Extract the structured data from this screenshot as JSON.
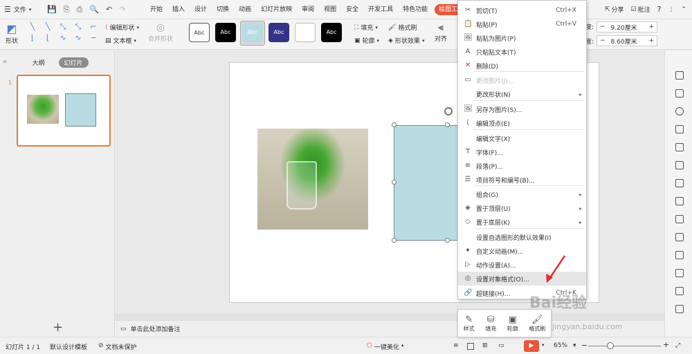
{
  "menubar": {
    "file_label": "文件",
    "tabs": [
      "开始",
      "插入",
      "设计",
      "切换",
      "动画",
      "幻灯片放映",
      "审阅",
      "视图",
      "安全",
      "开发工具",
      "特色功能",
      "绘图工具",
      "文"
    ],
    "active_tab": "绘图工具",
    "share_label": "分享",
    "comment_label": "批注",
    "help_label": "?"
  },
  "ribbon": {
    "shape_label": "形状",
    "edit_shape_label": "编辑形状",
    "textbox_label": "文本框",
    "merge_shape_label": "合并形状",
    "style_abc": "Abc",
    "fill_label": "填充",
    "outline_label": "轮廓",
    "format_brush_label": "格式刷",
    "shape_effect_label": "形状效果",
    "align_label": "对齐",
    "height_prefix": "度:",
    "width_prefix": "度:",
    "height_value": "9.20厘米",
    "width_value": "8.60厘米"
  },
  "leftpanel": {
    "outline_tab": "大纲",
    "slides_tab": "幻灯片",
    "slide_number": "1",
    "add_label": "+"
  },
  "notes": {
    "placeholder": "单击此处添加备注"
  },
  "context_menu": {
    "items": [
      {
        "label": "剪切(T)",
        "shortcut": "Ctrl+X",
        "icon": "scissors-icon",
        "disabled": false,
        "submenu": false
      },
      {
        "label": "粘贴(P)",
        "shortcut": "Ctrl+V",
        "icon": "paste-icon",
        "disabled": false,
        "submenu": false
      },
      {
        "label": "粘贴为图片(P)",
        "shortcut": "",
        "icon": "paste-picture-icon",
        "disabled": false,
        "submenu": false
      },
      {
        "label": "只粘贴文本(T)",
        "shortcut": "",
        "icon": "paste-text-icon",
        "disabled": false,
        "submenu": false
      },
      {
        "label": "删除(D)",
        "shortcut": "",
        "icon": "delete-icon",
        "disabled": false,
        "submenu": false
      },
      {
        "label": "更改图片(J)...",
        "shortcut": "",
        "icon": "change-picture-icon",
        "disabled": true,
        "submenu": false
      },
      {
        "label": "更改形状(N)",
        "shortcut": "",
        "icon": "",
        "disabled": false,
        "submenu": true
      },
      {
        "label": "另存为图片(S)...",
        "shortcut": "",
        "icon": "save-picture-icon",
        "disabled": false,
        "submenu": false
      },
      {
        "label": "编辑顶点(E)",
        "shortcut": "",
        "icon": "edit-points-icon",
        "disabled": false,
        "submenu": false
      },
      {
        "label": "编辑文字(X)",
        "shortcut": "",
        "icon": "",
        "disabled": false,
        "submenu": false
      },
      {
        "label": "字体(F)...",
        "shortcut": "",
        "icon": "font-icon",
        "disabled": false,
        "submenu": false
      },
      {
        "label": "段落(P)...",
        "shortcut": "",
        "icon": "paragraph-icon",
        "disabled": false,
        "submenu": false
      },
      {
        "label": "项目符号和编号(B)...",
        "shortcut": "",
        "icon": "bullets-icon",
        "disabled": false,
        "submenu": false
      },
      {
        "label": "组合(G)",
        "shortcut": "",
        "icon": "",
        "disabled": false,
        "submenu": true
      },
      {
        "label": "置于顶层(U)",
        "shortcut": "",
        "icon": "bring-front-icon",
        "disabled": false,
        "submenu": true
      },
      {
        "label": "置于底层(K)",
        "shortcut": "",
        "icon": "send-back-icon",
        "disabled": false,
        "submenu": true
      },
      {
        "label": "设置自选图形的默认效果(I)",
        "shortcut": "",
        "icon": "",
        "disabled": false,
        "submenu": false
      },
      {
        "label": "自定义动画(M)...",
        "shortcut": "",
        "icon": "animation-icon",
        "disabled": false,
        "submenu": false
      },
      {
        "label": "动作设置(A)...",
        "shortcut": "",
        "icon": "action-icon",
        "disabled": false,
        "submenu": false
      },
      {
        "label": "设置对象格式(O)...",
        "shortcut": "",
        "icon": "format-object-icon",
        "disabled": false,
        "submenu": false
      },
      {
        "label": "超链接(H)...",
        "shortcut": "Ctrl+K",
        "icon": "link-icon",
        "disabled": false,
        "submenu": false
      }
    ],
    "highlighted_index": 19
  },
  "minibar": {
    "style_label": "样式",
    "fill_label": "填充",
    "outline_label": "轮廓",
    "format_brush_label": "格式刷"
  },
  "statusbar": {
    "slide_info": "幻灯片 1 / 1",
    "template": "默认设计模板",
    "protection": "文档未保护",
    "beautify": "一键美化",
    "zoom": "65%"
  },
  "watermark": {
    "brand": "Bai经验",
    "url": "jingyan.baidu.com"
  },
  "colors": {
    "accent": "#e8563c",
    "shape_fill": "#b9dce2",
    "slide_border": "#e07d3a",
    "annotation_arrow": "#e03030"
  }
}
